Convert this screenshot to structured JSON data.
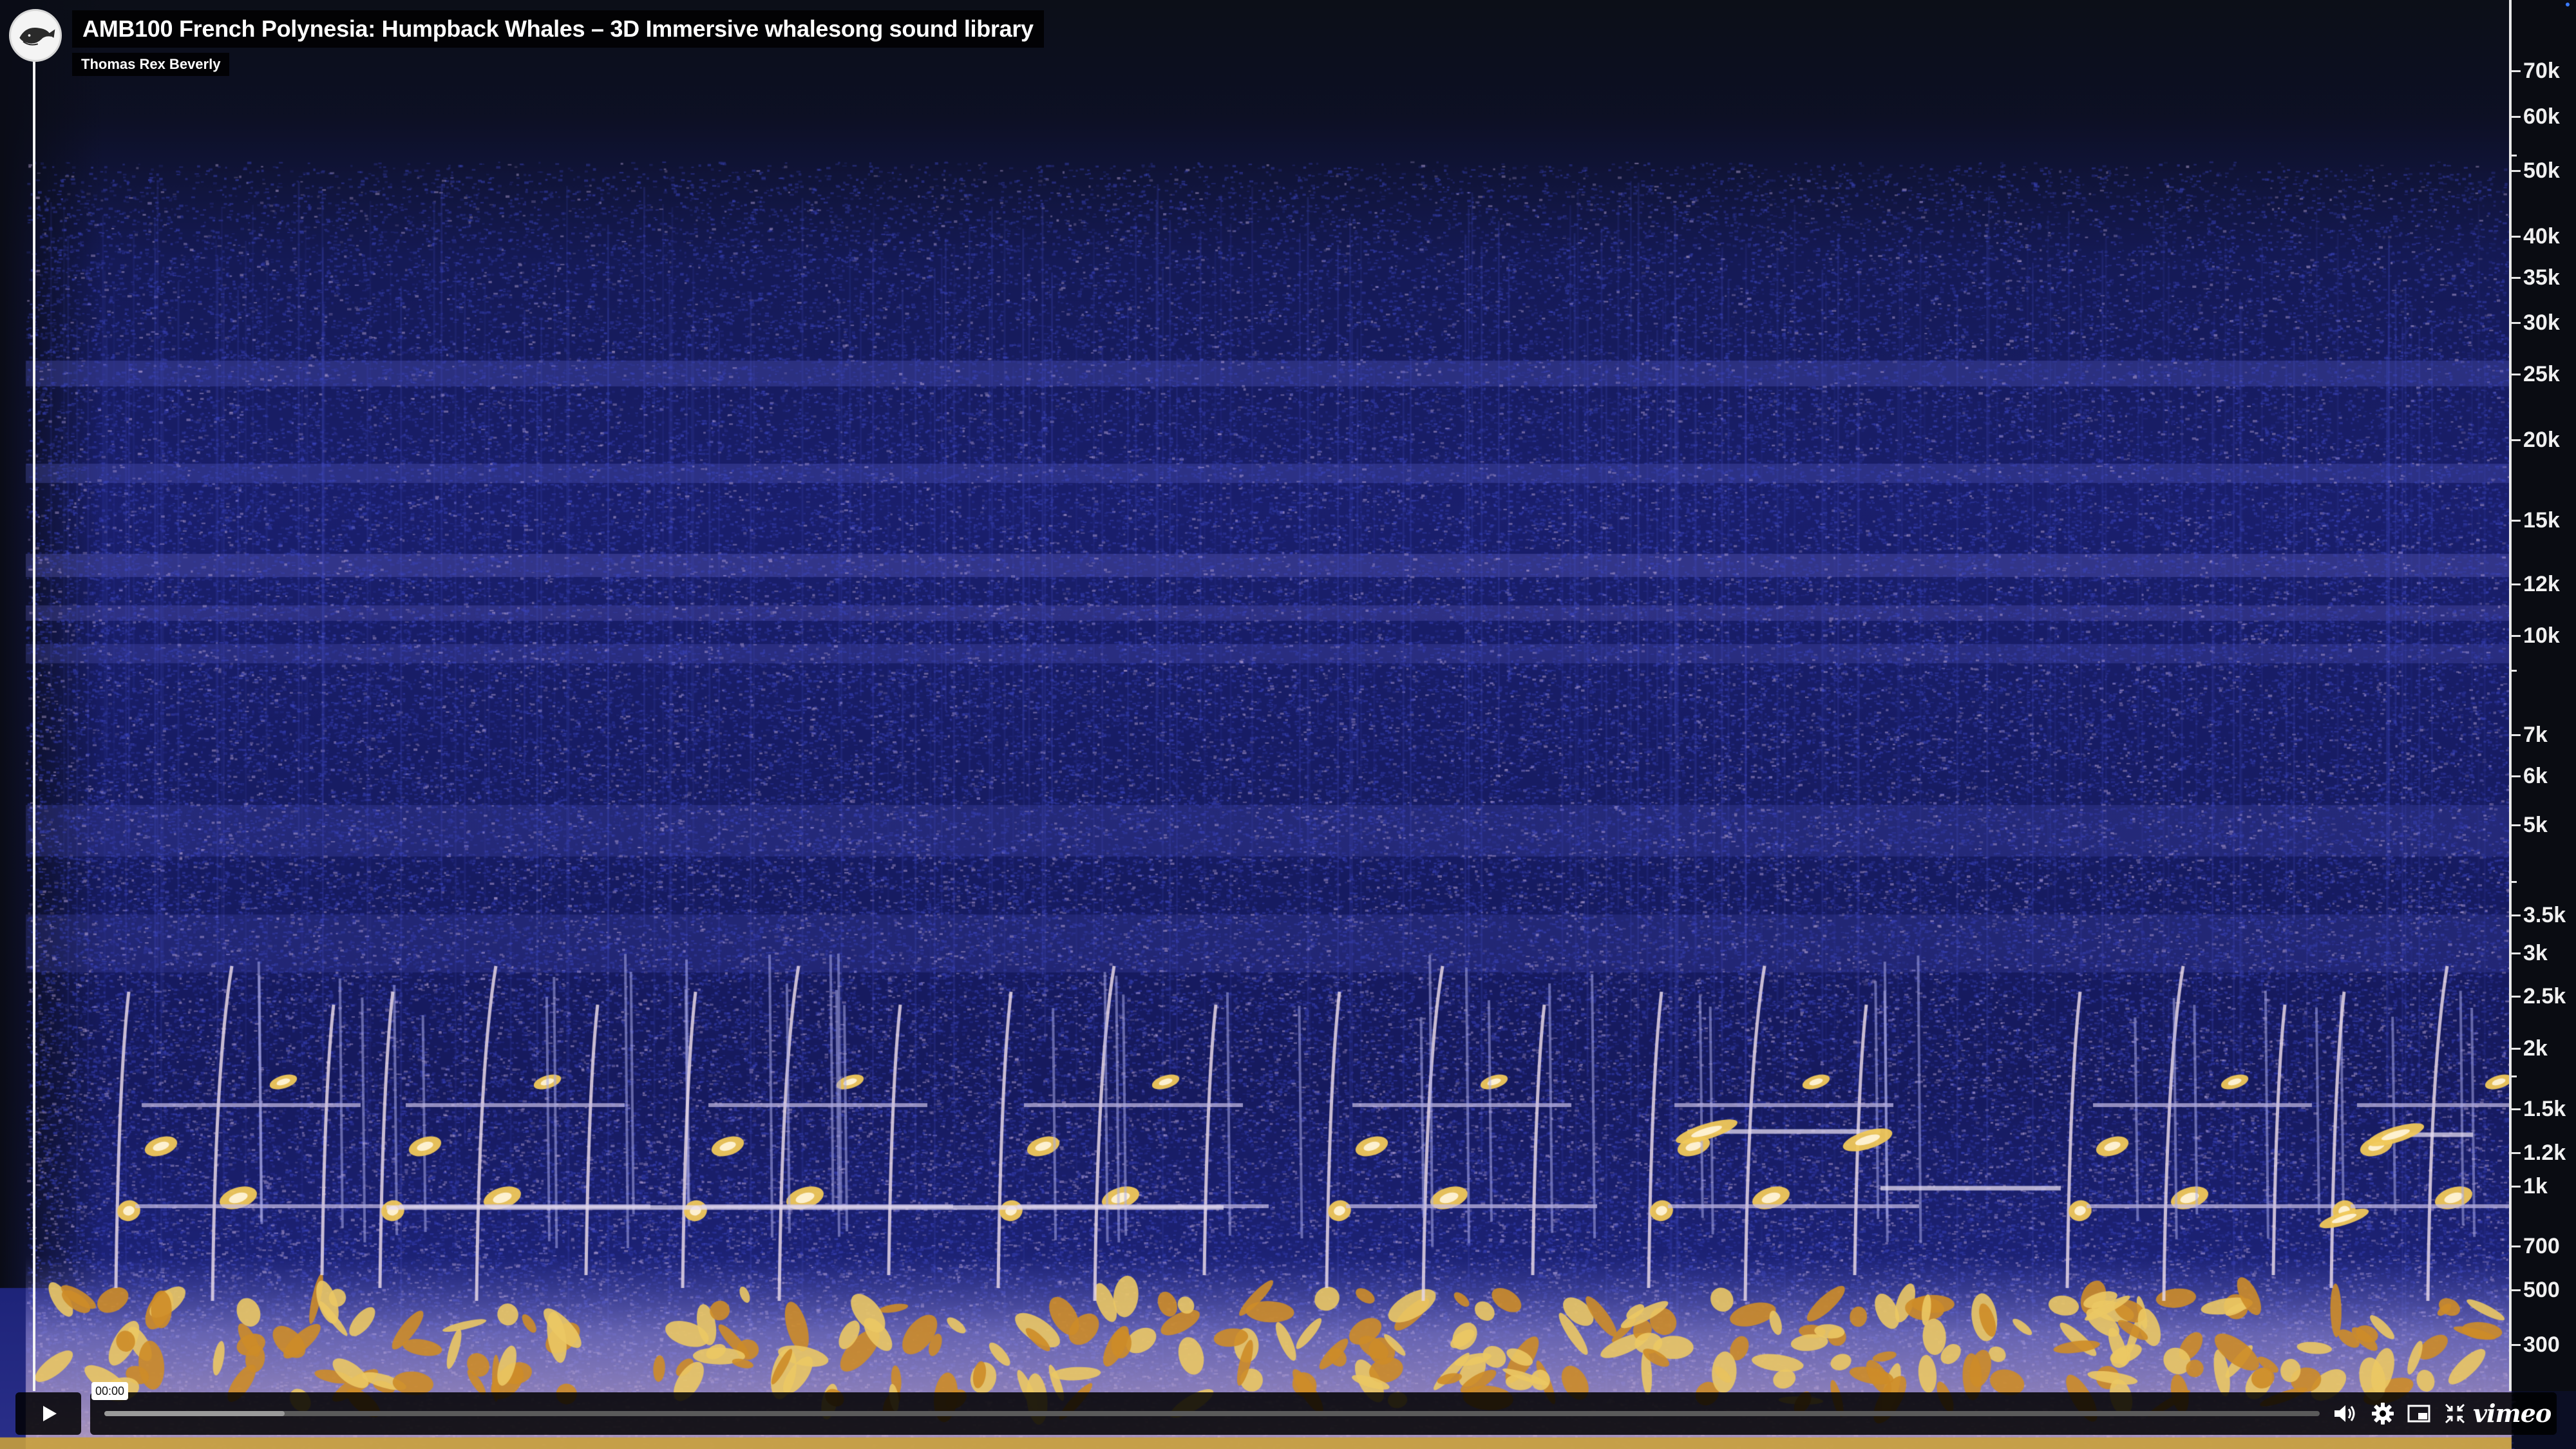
{
  "video": {
    "title": "AMB100 French Polynesia: Humpback Whales – 3D Immersive whalesong sound library",
    "byline": "Thomas Rex Beverly"
  },
  "spectrogram": {
    "frequency_labels": [
      "70k",
      "60k",
      "50k",
      "40k",
      "35k",
      "30k",
      "25k",
      "20k",
      "15k",
      "12k",
      "10k",
      "7k",
      "6k",
      "5k",
      "3.5k",
      "3k",
      "2.5k",
      "2k",
      "1.5k",
      "1.2k",
      "1k",
      "700",
      "500",
      "300"
    ],
    "colormap": [
      "#0b0d2a",
      "#1b1f6e",
      "#3a3fb5",
      "#8d8fd6",
      "#d9b7a6",
      "#e9c96a",
      "#c98a1e"
    ]
  },
  "player": {
    "current_time": "00:00",
    "progress": 0,
    "icons": {
      "play": "play-icon",
      "volume": "volume-icon",
      "settings": "gear-icon",
      "pip": "picture-in-picture-icon",
      "fullscreen": "fullscreen-icon"
    },
    "brand": "vimeo"
  },
  "colors": {
    "background": "#0b0e24",
    "axis_text": "#f0f0f0",
    "overlay_bg": "#000000"
  }
}
